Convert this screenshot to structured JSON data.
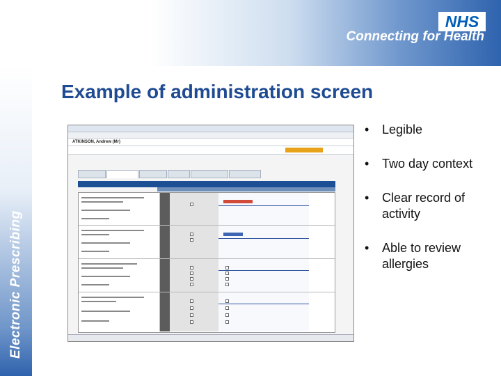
{
  "brand": {
    "logo": "NHS",
    "tagline": "Connecting for Health",
    "side_label": "Electronic Prescribing"
  },
  "slide": {
    "title": "Example of administration screen",
    "bullets": [
      "Legible",
      "Two day context",
      "Clear record of activity",
      "Able to review allergies"
    ]
  },
  "screenshot": {
    "patient_name": "ATKINSON, Andrew (Mr)"
  },
  "colors": {
    "title": "#1f4b92",
    "header_blue": "#2e63ae",
    "toolbar_blue": "#1d4f94",
    "allergy_orange": "#e8a21a",
    "overdue_red": "#d24a3a"
  }
}
